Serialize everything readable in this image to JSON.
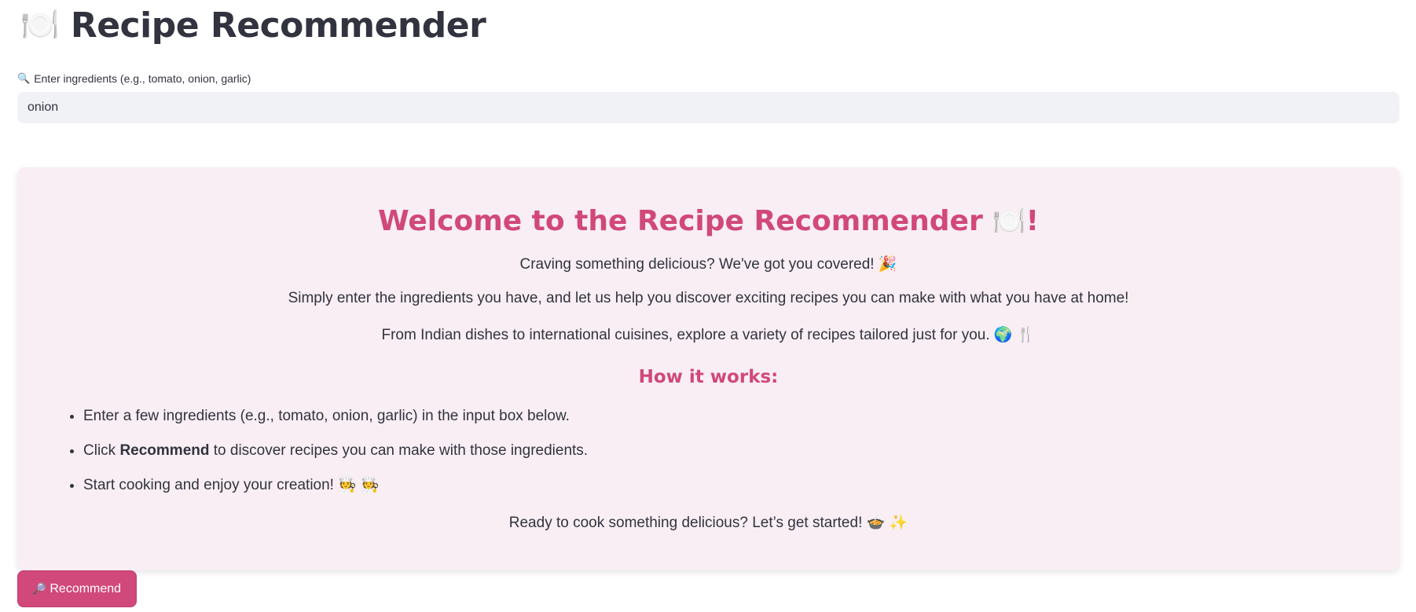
{
  "header": {
    "title_icon": "🍽️",
    "title": "Recipe Recommender"
  },
  "ingredient_input": {
    "label_icon": "🔍",
    "label": "Enter ingredients (e.g., tomato, onion, garlic)",
    "value": "onion"
  },
  "welcome": {
    "title": "Welcome to the Recipe Recommender",
    "title_icon": "🍽️",
    "title_suffix": "!",
    "line1": "Craving something delicious? We've got you covered!",
    "line1_icon": "🎉",
    "line2": "Simply enter the ingredients you have, and let us help you discover exciting recipes you can make with what you have at home!",
    "line3": "From Indian dishes to international cuisines, explore a variety of recipes tailored just for you.",
    "line3_icons": "🌍 🍴",
    "how_title": "How it works:",
    "steps": {
      "step1": "Enter a few ingredients (e.g., tomato, onion, garlic) in the input box below.",
      "step2_prefix": "Click",
      "step2_bold": "Recommend",
      "step2_suffix": "to discover recipes you can make with those ingredients.",
      "step3": "Start cooking and enjoy your creation!",
      "step3_icons": "🧑‍🍳 🧑‍🍳"
    },
    "closing": "Ready to cook something delicious? Let’s get started!",
    "closing_icons": "🍲 ✨"
  },
  "recommend_button": {
    "icon": "🔎",
    "label": "Recommend"
  },
  "colors": {
    "accent": "#d1487a",
    "card_background": "#f8eef3",
    "input_background": "#f0f2f6",
    "text": "#31333f"
  }
}
